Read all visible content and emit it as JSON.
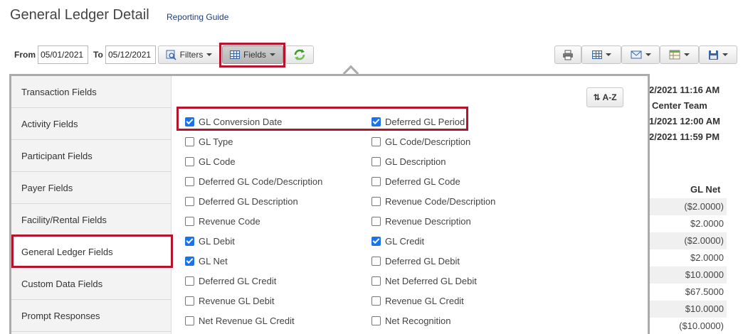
{
  "header": {
    "title": "General Ledger Detail",
    "guide_link": "Reporting Guide"
  },
  "date_range": {
    "from_label": "From",
    "from_value": "05/01/2021",
    "to_label": "To",
    "to_value": "05/12/2021"
  },
  "toolbar": {
    "filters_label": "Filters",
    "fields_label": "Fields"
  },
  "sort_button": {
    "label": "A-Z"
  },
  "categories": [
    "Transaction Fields",
    "Activity Fields",
    "Participant Fields",
    "Payer Fields",
    "Facility/Rental Fields",
    "General Ledger Fields",
    "Custom Data Fields",
    "Prompt Responses"
  ],
  "active_category": "General Ledger Fields",
  "fields_left": [
    {
      "label": "GL Conversion Date",
      "checked": true
    },
    {
      "label": "GL Type",
      "checked": false
    },
    {
      "label": "GL Code",
      "checked": false
    },
    {
      "label": "Deferred GL Code/Description",
      "checked": false
    },
    {
      "label": "Deferred GL Description",
      "checked": false
    },
    {
      "label": "Revenue Code",
      "checked": false
    },
    {
      "label": "GL Debit",
      "checked": true
    },
    {
      "label": "GL Net",
      "checked": true
    },
    {
      "label": "Deferred GL Credit",
      "checked": false
    },
    {
      "label": "Revenue GL Debit",
      "checked": false
    },
    {
      "label": "Net Revenue GL Credit",
      "checked": false
    }
  ],
  "fields_right": [
    {
      "label": "Deferred GL Period",
      "checked": true
    },
    {
      "label": "GL Code/Description",
      "checked": false
    },
    {
      "label": "GL Description",
      "checked": false
    },
    {
      "label": "Deferred GL Code",
      "checked": false
    },
    {
      "label": "Revenue Code/Description",
      "checked": false
    },
    {
      "label": "Revenue Description",
      "checked": false
    },
    {
      "label": "GL Credit",
      "checked": true
    },
    {
      "label": "Deferred GL Debit",
      "checked": false
    },
    {
      "label": "Net Deferred GL Debit",
      "checked": false
    },
    {
      "label": "Revenue GL Credit",
      "checked": false
    },
    {
      "label": "Net Recognition",
      "checked": false
    }
  ],
  "report_info": {
    "line1": "2/2021 11:16 AM",
    "line2": "Center Team",
    "line3": "1/2021 12:00 AM",
    "line4": "2/2021 11:59 PM"
  },
  "gl_net": {
    "header": "GL Net",
    "values": [
      "($2.0000)",
      "$2.0000",
      "($2.0000)",
      "$2.0000",
      "$10.0000",
      "$67.5000",
      "$10.0000",
      "($10.0000)"
    ]
  },
  "colors": {
    "highlight": "#b5132e",
    "checkbox": "#1a73e8",
    "link": "#1d3f7a"
  }
}
